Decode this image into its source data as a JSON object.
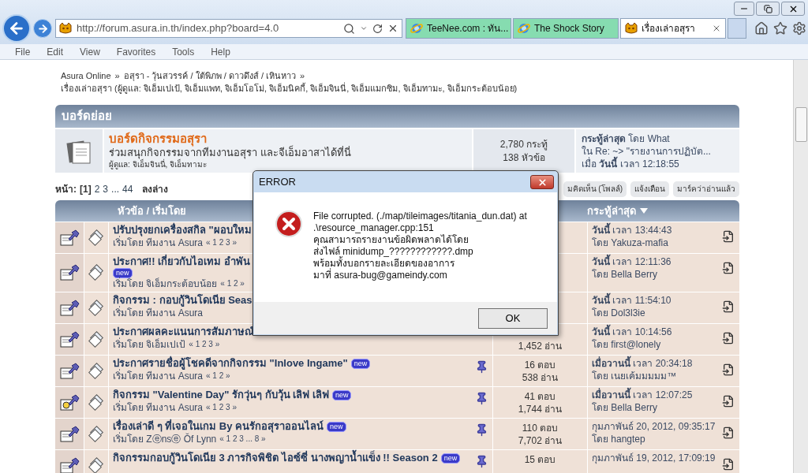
{
  "browser": {
    "address": "http://forum.asura.in.th/index.php?board=4.0",
    "tabs": [
      {
        "title": "TeeNee.com : ทัน...",
        "selected": false
      },
      {
        "title": "The Shock Story",
        "selected": false
      },
      {
        "title": "เรื่องเล่าอสุรา",
        "selected": true
      }
    ],
    "menu": [
      "File",
      "Edit",
      "View",
      "Favorites",
      "Tools",
      "Help"
    ]
  },
  "breadcrumb": {
    "links": [
      "Asura Online",
      "อสุรา - วุ้นสวรรค์ / ใต้พิภพ / ดาวดึงส์ / เหินหาว"
    ],
    "separator": "»",
    "board_line": "เรื่องเล่าอสุรา (ผู้ดูแล: จิเอ็มเปเป้, จิเอ็มแพท, จิเอ็มโอโม่, จิเอ็มนิคกี้, จิเอ็มจินนี่, จิเอ็มแมกซิม, จิเอ็มทามะ, จิเอ็มกระต้อบน้อย)"
  },
  "child_boards": {
    "heading": "บอร์ดย่อย",
    "boards": [
      {
        "name": "บอร์ดกิจกรรมอสุรา",
        "description": "ร่วมสนุกกิจกรรมจากทีมงานอสุรา และจีเอ็มอาสาได้ที่นี่",
        "moderators": "ผู้ดูแล: จิเอ็มจินนี่, จิเอ็มทามะ",
        "posts": "2,780 กระทู้",
        "topics": "138 หัวข้อ",
        "last_post": [
          "**กระทู้ล่าสุด** โดย What",
          "ใน Re: ~> \"รายงานการปฏิบัต...",
          "เมื่อ **วันนี้** เวลา 12:18:55"
        ]
      }
    ]
  },
  "pagination": {
    "label": "หน้า:",
    "pages": [
      {
        "label": "[1]",
        "selected": true
      },
      {
        "label": "2",
        "selected": false
      },
      {
        "label": "3",
        "selected": false
      },
      {
        "label": "...",
        "selected": false
      },
      {
        "label": "44",
        "selected": false
      }
    ],
    "bottom_link": "ลงล่าง"
  },
  "actions": [
    "มคิดเห็น (โพลล์)",
    "แจ้งเตือน",
    "มาร์คว่าอ่านแล้ว"
  ],
  "topics": {
    "columns": [
      "หัวข้อ / เริ่มโดย",
      "กระทู้ล่าสุด"
    ],
    "rows": [
      {
        "kind": "pin",
        "title": "ปรับปรุงยกเครื่องสกิล \"ผอบใหม",
        "starter": "เริ่มโดย ทีมงาน Asura",
        "pages": "« 1 2 3 »",
        "last_time": "**วันนี้** เวลา 13:44:43",
        "last_by": "โดย Yakuza-mafia"
      },
      {
        "kind": "pin",
        "title": "ประกาศ!! เกี่ยวกับไอเทม อำพัน",
        "wrapped_badge": "new",
        "starter": "เริ่มโดย จิเอ็มกระต้อบน้อย",
        "pages": "« 1 2 »",
        "last_time": "**วันนี้** เวลา 12:11:36",
        "last_by": "โดย Bella Berry"
      },
      {
        "kind": "pin",
        "title": "กิจกรรม : กอบกู้วินโดเนีย Seas",
        "starter": "เริ่มโดย ทีมงาน Asura",
        "last_time": "**วันนี้** เวลา 11:54:10",
        "last_by": "โดย Dol3l3ie"
      },
      {
        "kind": "pin",
        "title": "ประกาศผลคะแนนการสัมภาษณ์",
        "starter": "เริ่มโดย จิเอ็มเปเป้",
        "pages": "« 1 2 3 »",
        "views": "1,452 อ่าน",
        "last_time": "**วันนี้** เวลา 10:14:56",
        "last_by": "โดย first@lonely"
      },
      {
        "kind": "pin",
        "title": "ประกาศรายชื่อผู้โชคดีจากกิจกรรม \"Inlove Ingame\"",
        "badge": "new",
        "starter": "เริ่มโดย ทีมงาน Asura",
        "pages": "« 1 2 »",
        "pinned": true,
        "replies": "16 ตอบ",
        "views": "538 อ่าน",
        "last_time": "**เมื่อวานนี้** เวลา 20:34:18",
        "last_by": "โดย เนยเค้มมมมม™"
      },
      {
        "kind": "smiley",
        "title": "กิจกรรม \"Valentine Day\" รักวุ่นๆ กับวุ้น เลิฟ เลิฟ",
        "badge": "new",
        "starter": "เริ่มโดย ทีมงาน Asura",
        "pages": "« 1 2 3 »",
        "pinned": true,
        "replies": "41 ตอบ",
        "views": "1,744 อ่าน",
        "last_time": "**เมื่อวานนี้** เวลา 12:07:25",
        "last_by": "โดย Bella Berry"
      },
      {
        "kind": "pin",
        "title": "เรื่องเล่าดี ๆ ที่เจอในเกม By คนรักอสุราออนไลน์",
        "badge": "new",
        "starter": "เริ่มโดย Zⓔnsⓔ Ŏf Lynn",
        "pages": "« 1 2 3 ... 8 »",
        "pinned": true,
        "replies": "110 ตอบ",
        "views": "7,702 อ่าน",
        "last_time": "กุมภาพันธ์ 20, 2012, 09:35:17",
        "last_by": "โดย hangtep"
      },
      {
        "kind": "pin",
        "title": "กิจกรรมกอบกู้วินโดเนีย 3 ภารกิจพิชิต ไอซ์ซี่ นางพญาน้ำแข็ง !! Season 2",
        "badge": "new",
        "pinned": true,
        "replies": "15 ตอบ",
        "last_time": "กุมภาพันธ์ 19, 2012, 17:09:19"
      }
    ]
  },
  "dialog": {
    "title": "ERROR",
    "lines": [
      "File corrupted. (./map/tileimages/titania_dun.dat) at",
      ".\\resource_manager.cpp:151",
      "คุณสามารถรายงานข้อผิดพลาดได้โดย",
      "ส่งไฟล์ minidump_????????????.dmp",
      "พร้อมทั้งบอกรายละเอียดของอาการ",
      "มาที่ asura-bug@gameindy.com"
    ],
    "button": "OK"
  }
}
